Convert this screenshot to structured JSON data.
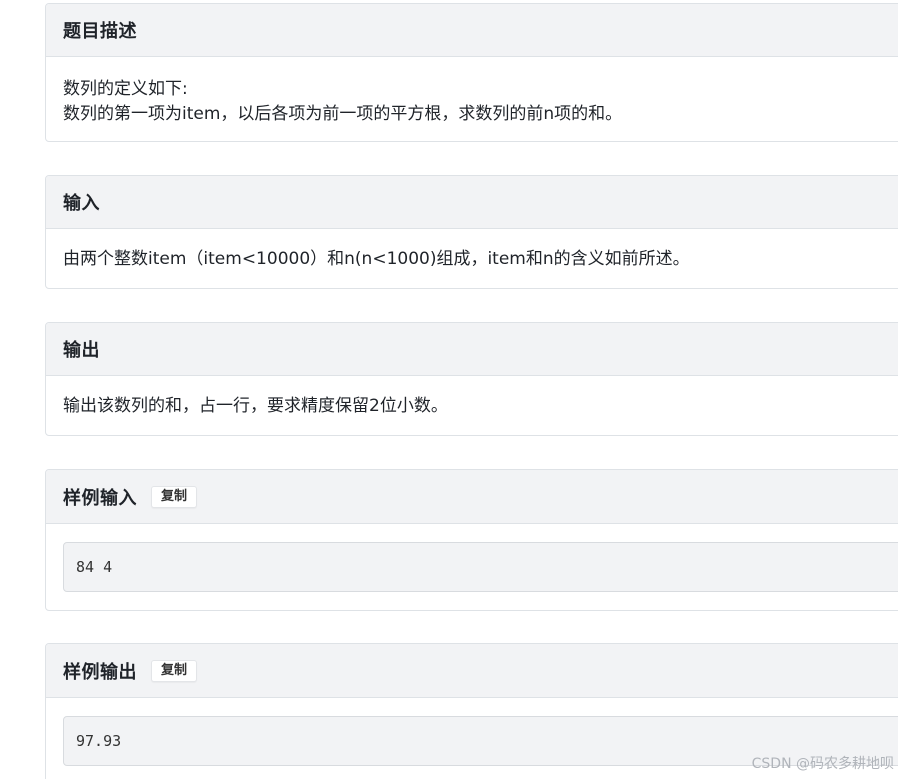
{
  "sections": {
    "description": {
      "title": "题目描述",
      "lines": [
        "数列的定义如下:",
        "数列的第一项为item，以后各项为前一项的平方根，求数列的前n项的和。"
      ]
    },
    "input": {
      "title": "输入",
      "lines": [
        "由两个整数item（item<10000）和n(n<1000)组成，item和n的含义如前所述。"
      ]
    },
    "output": {
      "title": "输出",
      "lines": [
        "输出该数列的和，占一行，要求精度保留2位小数。"
      ]
    },
    "sample_input": {
      "title": "样例输入",
      "copy_label": "复制",
      "code": "84 4"
    },
    "sample_output": {
      "title": "样例输出",
      "copy_label": "复制",
      "code": "97.93"
    }
  },
  "watermark": "CSDN @码农多耕地呗"
}
